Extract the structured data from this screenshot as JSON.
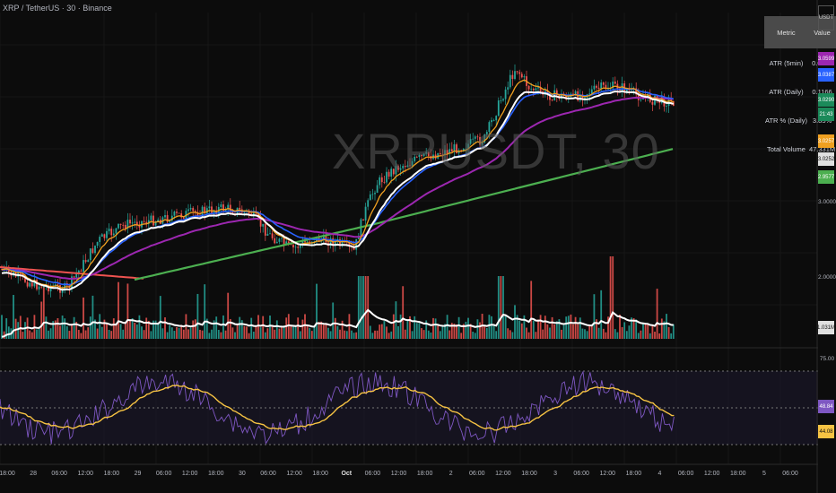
{
  "header": {
    "title": "XRP / TetherUS · 30 · Binance"
  },
  "watermark": "XRPUSDT, 30",
  "stats_table": {
    "headers": [
      "Metric",
      "Value"
    ],
    "rows": [
      [
        "ATR (5min)",
        "0.0036"
      ],
      [
        "ATR (Daily)",
        "0.1166"
      ],
      [
        "ATR % (Daily)",
        "3.85%"
      ],
      [
        "Total Volume",
        "47.331M"
      ]
    ]
  },
  "price_scale": {
    "currency": "USDT",
    "ticks": [
      "3.0000",
      "2.0000"
    ],
    "badges": [
      {
        "label": "3.0599",
        "color": "#9c27b0"
      },
      {
        "label": "3.0387",
        "color": "#2962ff"
      },
      {
        "label": "3.0290",
        "color": "#1b8a5a"
      },
      {
        "label": "21:43",
        "color": "#1b8a5a"
      },
      {
        "label": "3.0257",
        "color": "#f0a020"
      },
      {
        "label": "3.0252",
        "color": "#e0e0e0"
      },
      {
        "label": "2.9577",
        "color": "#4caf50"
      }
    ],
    "volume_badge": {
      "label": "1.031M",
      "color": "#e0e0e0"
    },
    "osc_ticks": [
      "75.00"
    ],
    "osc_badges": [
      {
        "label": "48.84",
        "color": "#7e57c2"
      },
      {
        "label": "44.08",
        "color": "#f6c343"
      }
    ]
  },
  "time_axis": {
    "labels": [
      "18:00",
      "28",
      "06:00",
      "12:00",
      "18:00",
      "29",
      "06:00",
      "12:00",
      "18:00",
      "30",
      "06:00",
      "12:00",
      "18:00",
      "Oct",
      "06:00",
      "12:00",
      "18:00",
      "2",
      "06:00",
      "12:00",
      "18:00",
      "3",
      "06:00",
      "12:00",
      "18:00",
      "4",
      "06:00",
      "12:00",
      "18:00",
      "5",
      "06:00"
    ]
  },
  "colors": {
    "up": "#26a69a",
    "down": "#ef5350",
    "ema_fast": "#f0a020",
    "ema_mid": "#2962ff",
    "ema_slow": "#9c27b0",
    "ema_long": "#4caf50",
    "vwap": "#ffffff",
    "ema_red": "#ef5350",
    "rsi": "#7e57c2",
    "rsi_ma": "#f6c343"
  }
}
